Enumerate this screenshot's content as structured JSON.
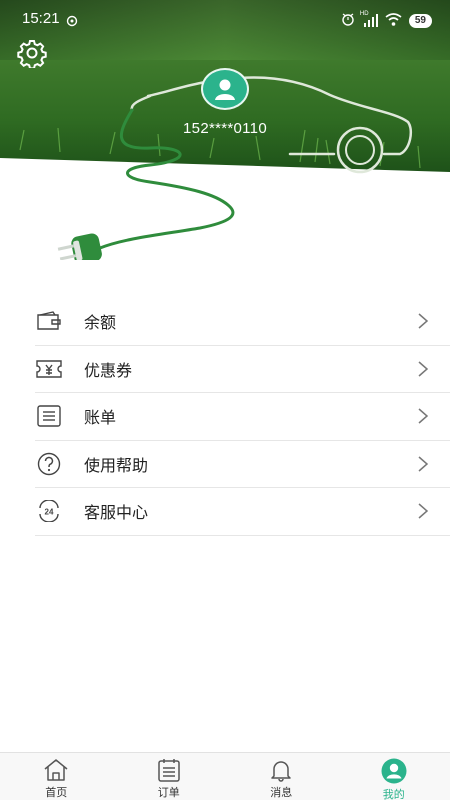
{
  "status_bar": {
    "time": "15:21",
    "battery": "59",
    "network": "HD"
  },
  "profile": {
    "phone": "152****0110"
  },
  "menu": [
    {
      "label": "余额",
      "icon": "wallet-icon"
    },
    {
      "label": "优惠券",
      "icon": "coupon-icon"
    },
    {
      "label": "账单",
      "icon": "bill-icon"
    },
    {
      "label": "使用帮助",
      "icon": "help-icon"
    },
    {
      "label": "客服中心",
      "icon": "service-24h-icon"
    }
  ],
  "tabbar": {
    "tabs": [
      {
        "label": "首页",
        "icon": "home-icon"
      },
      {
        "label": "订单",
        "icon": "order-icon"
      },
      {
        "label": "消息",
        "icon": "bell-icon"
      },
      {
        "label": "我的",
        "icon": "user-icon"
      }
    ],
    "active": "我的"
  },
  "colors": {
    "accent": "#2bb38c",
    "grass": "#3a7d2e",
    "cable": "#2f8c3c"
  }
}
